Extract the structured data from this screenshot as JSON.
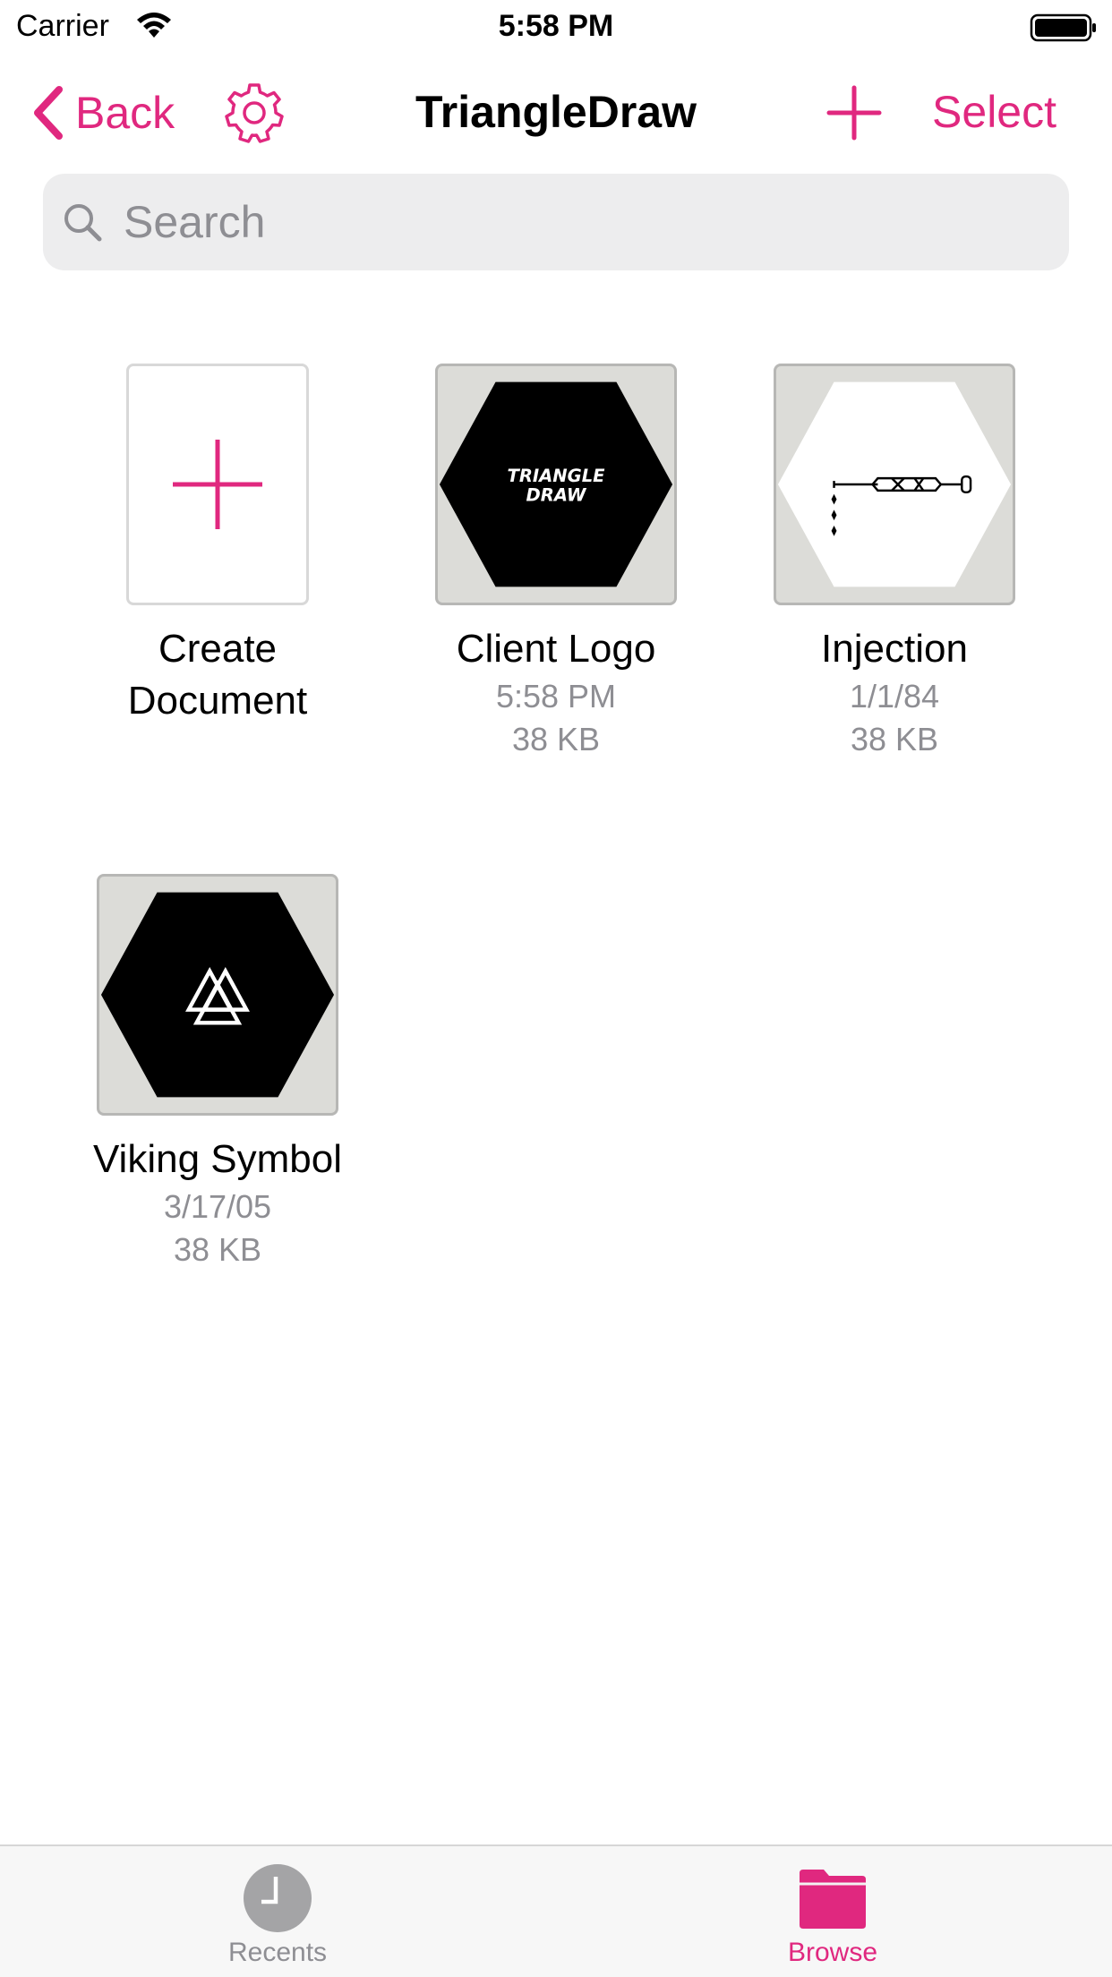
{
  "status_bar": {
    "carrier": "Carrier",
    "time": "5:58 PM"
  },
  "nav": {
    "back_label": "Back",
    "title": "TriangleDraw",
    "select_label": "Select"
  },
  "search": {
    "placeholder": "Search"
  },
  "create_document": {
    "line1": "Create",
    "line2": "Document"
  },
  "documents": [
    {
      "name": "Client Logo",
      "date": "5:58 PM",
      "size": "38 KB",
      "thumbnail_text_1": "TRIANGLE",
      "thumbnail_text_2": "DRAW"
    },
    {
      "name": "Injection",
      "date": "1/1/84",
      "size": "38 KB"
    },
    {
      "name": "Viking Symbol",
      "date": "3/17/05",
      "size": "38 KB"
    }
  ],
  "tabs": [
    {
      "label": "Recents",
      "icon": "clock-icon",
      "active": false
    },
    {
      "label": "Browse",
      "icon": "folder-icon",
      "active": true
    }
  ],
  "colors": {
    "accent": "#e0287f",
    "inactive": "#8e8e93",
    "thumbnail_bg": "#dcdcd8"
  }
}
